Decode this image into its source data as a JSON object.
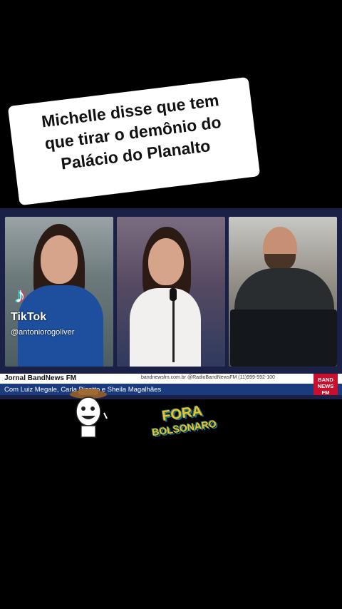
{
  "caption": {
    "line1": "Michelle disse que tem",
    "line2": "que tirar o demônio do",
    "line3": "Palácio do Planalto"
  },
  "watermark": {
    "app": "TikTok",
    "username": "@antoniorogoliver"
  },
  "ticker": {
    "show_name": "Jornal BandNews FM",
    "contacts": "bandnewsfm.com.br   @RadioBandNewsFM   (11)999-592-100",
    "hosts": "Com Luiz Megale, Carla Bigatto e Sheila Magalhães",
    "logo_line1": "BAND",
    "logo_line2": "NEWS",
    "logo_line3": "FM"
  },
  "stickers": {
    "fora_line1": "FORA",
    "fora_line2": "BOLSONARO"
  },
  "colors": {
    "background": "#000000",
    "ticker_blue": "#1a3b7d",
    "band_red": "#c8102e",
    "sticker_yellow": "#f2c21a"
  }
}
